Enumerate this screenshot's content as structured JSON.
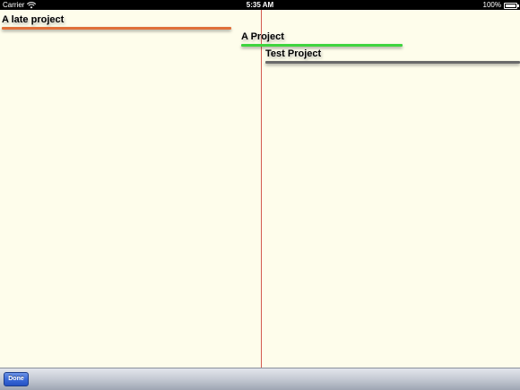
{
  "status_bar": {
    "carrier": "Carrier",
    "time": "5:35 AM",
    "battery": "100%",
    "battery_level": 1.0
  },
  "timeline": {
    "today_line_color": "#d45b4f",
    "background_color": "#fefdeb",
    "projects": [
      {
        "name": "A late project",
        "color": "#e0703a"
      },
      {
        "name": "A Project",
        "color": "#3fd43f"
      },
      {
        "name": "Test Project",
        "color": "#6a6a6a"
      }
    ]
  },
  "toolbar": {
    "done_label": "Done"
  }
}
